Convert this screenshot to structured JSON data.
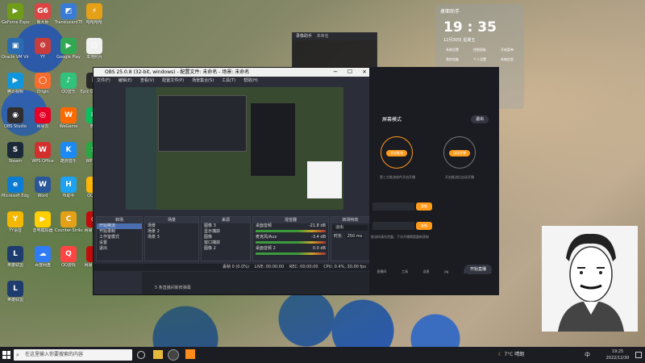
{
  "desktop_icons": [
    {
      "label": "GeForce Experience",
      "color": "#6f9d1a",
      "glyph": "▶"
    },
    {
      "label": "鲁大师",
      "color": "#d44",
      "glyph": "G6"
    },
    {
      "label": "TranslucentTB",
      "color": "#3a7bd5",
      "glyph": "◩"
    },
    {
      "label": "哈哈哈哈",
      "color": "#e4a016",
      "glyph": "⚡"
    },
    {
      "label": "Oracle VM VirtualBox",
      "color": "#2b6cb0",
      "glyph": "▣"
    },
    {
      "label": "YY",
      "color": "#c93c3c",
      "glyph": "⚙"
    },
    {
      "label": "Google Play",
      "color": "#32a852",
      "glyph": "▶"
    },
    {
      "label": "本地照片",
      "color": "#f0f0f0",
      "glyph": "☺"
    },
    {
      "label": "腾讯视频",
      "color": "#1296db",
      "glyph": "▶"
    },
    {
      "label": "Origin",
      "color": "#f56c2d",
      "glyph": "◯"
    },
    {
      "label": "QQ音乐",
      "color": "#31c27c",
      "glyph": "♪"
    },
    {
      "label": "Epic Games Launcher",
      "color": "#2a2a2a",
      "glyph": "E"
    },
    {
      "label": "OBS Studio",
      "color": "#302e31",
      "glyph": "◉"
    },
    {
      "label": "网易云",
      "color": "#e60026",
      "glyph": "◎"
    },
    {
      "label": "WeGame",
      "color": "#ff6a00",
      "glyph": "W"
    },
    {
      "label": "微信",
      "color": "#07c160",
      "glyph": "✉"
    },
    {
      "label": "Steam",
      "color": "#1b2838",
      "glyph": "S"
    },
    {
      "label": "WPS Office",
      "color": "#d32f2f",
      "glyph": "W"
    },
    {
      "label": "酷狗音乐",
      "color": "#1c8af4",
      "glyph": "K"
    },
    {
      "label": "WPS表格",
      "color": "#27a844",
      "glyph": "S"
    },
    {
      "label": "Microsoft Edge",
      "color": "#0c7bd3",
      "glyph": "e"
    },
    {
      "label": "Word",
      "color": "#2b579a",
      "glyph": "W"
    },
    {
      "label": "Hi助手",
      "color": "#1da1f2",
      "glyph": "H"
    },
    {
      "label": "QQ游戏",
      "color": "#ffb400",
      "glyph": "☀"
    },
    {
      "label": "YY语音",
      "color": "#f5b800",
      "glyph": "Y"
    },
    {
      "label": "雷电模拟器",
      "color": "#ffcf00",
      "glyph": "▶"
    },
    {
      "label": "Counter-Strike Global",
      "color": "#e4a016",
      "glyph": "C"
    },
    {
      "label": "网易云音乐",
      "color": "#c20c0c",
      "glyph": "◉"
    },
    {
      "label": "英雄联盟",
      "color": "#1e3c6e",
      "glyph": "L"
    },
    {
      "label": "百度网盘",
      "color": "#2f7cf6",
      "glyph": "☁"
    },
    {
      "label": "QQ游戏",
      "color": "#f44",
      "glyph": "Q"
    },
    {
      "label": "网易云音乐",
      "color": "#c20c0c",
      "glyph": "♪"
    },
    {
      "label": "英雄联盟",
      "color": "#1e3c6e",
      "glyph": "L"
    }
  ],
  "obs": {
    "title": "OBS 25.0.8 (32-bit, windows) - 配置文件: 未命名 - 场景: 未命名",
    "menu": [
      "文件(F)",
      "编辑(E)",
      "查看(V)",
      "配置文件(P)",
      "场景集合(S)",
      "工具(T)",
      "帮助(H)"
    ],
    "docks": {
      "scene_transition_title": "转场",
      "scenes_title": "场景",
      "sources_title": "来源",
      "mixer_title": "混音器",
      "transitions_title": "转场特效",
      "left_items": [
        "开始推流",
        "开始录制",
        "工作室模式",
        "设置",
        "退出"
      ],
      "scenes": [
        "场景",
        "场景 2",
        "场景 3"
      ],
      "sources": [
        "图像 3",
        "显示捕获",
        "图像",
        "窗口捕获",
        "图像 2"
      ],
      "mixer": [
        {
          "name": "桌面音频",
          "db": "-21.8 dB"
        },
        {
          "name": "麦克风/Aux",
          "db": "-3.4 dB"
        },
        {
          "name": "桌面音频 2",
          "db": "0.0 dB"
        }
      ],
      "transition_value": "淡出",
      "duration_label": "时长",
      "duration_value": "250 ms"
    },
    "status": {
      "drop": "丢帧 0 (0.0%)",
      "live": "LIVE: 00:00:00",
      "rec": "REC: 00:00:00",
      "cpu": "CPU: 0.4%, 30.00 fps"
    },
    "bottom_hint": "5 条直播间新鲜弹幕"
  },
  "mirror": {
    "mode_label": "屏幕模式",
    "exit_label": "退出",
    "left_btn": "开启推流",
    "right_btn": "自动开播",
    "left_desc": "第三方推流软件开启开播",
    "right_desc": "开启推流后自动开播",
    "copy_btn": "复制",
    "copy_btn2": "复制",
    "note": "推流码请勿泄露，下次开播需要重新获取",
    "bottom_items": [
      "直播间",
      "工具",
      "连麦",
      "PK",
      "互动",
      "设置"
    ],
    "bottom_action": "开始直播"
  },
  "floatwin": {
    "title": "录像助手",
    "subtitle": "未命名"
  },
  "clock_widget": {
    "title": "桌面助手",
    "time": "19 : 35",
    "date": "12月30日 星期五",
    "items": [
      "系统设置",
      "控制面板",
      "开始菜单",
      "我的电脑",
      "个人设置",
      "系统信息"
    ]
  },
  "taskbar": {
    "search_placeholder": "在这里输入你要搜索的内容",
    "weather": "7°C 晴朗",
    "ime": "中",
    "time": "19:25",
    "date": "2022/12/30"
  }
}
